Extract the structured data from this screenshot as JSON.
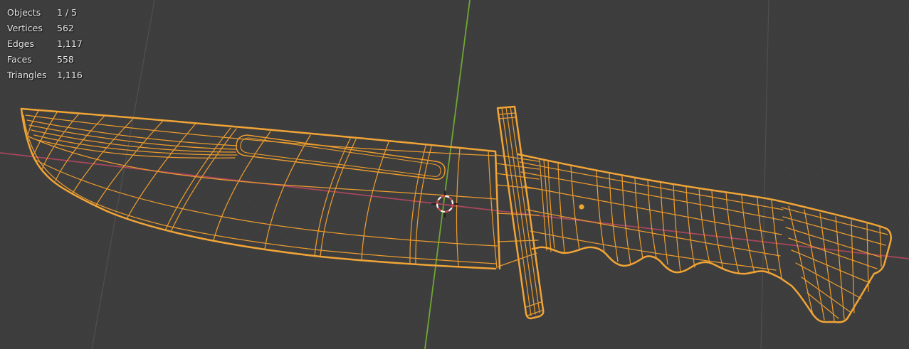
{
  "viewport": {
    "app": "3D viewport",
    "stats": {
      "rows": [
        {
          "label": "Objects",
          "value": "1 / 5"
        },
        {
          "label": "Vertices",
          "value": "562"
        },
        {
          "label": "Edges",
          "value": "1,117"
        },
        {
          "label": "Faces",
          "value": "558"
        },
        {
          "label": "Triangles",
          "value": "1,116"
        }
      ]
    }
  },
  "colors": {
    "background": "#3c3c3c",
    "wireframe": "#ef9d2c",
    "wireframe_bright": "#f6a735",
    "axis_y_green": "#6fa832",
    "axis_x_red": "#a8455c",
    "grid_line": "#4f4f4f",
    "cursor_red": "#cc4444",
    "cursor_white": "#ffffff",
    "origin_dot": "#f5a832",
    "stats_text": "#e6e6e6"
  }
}
